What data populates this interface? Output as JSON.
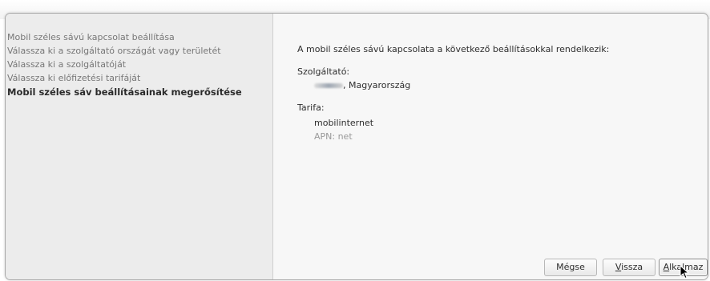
{
  "sidebar": {
    "steps": [
      "Mobil széles sávú kapcsolat beállítása",
      "Válassza ki a szolgáltató országát vagy területét",
      "Válassza ki a szolgáltatóját",
      "Válassza ki előfizetési tarifáját",
      "Mobil széles sáv beállításainak megerősítése"
    ],
    "active_index": 4
  },
  "summary": {
    "intro": "A mobil széles sávú kapcsolata a következő beállításokkal rendelkezik:",
    "provider_label": "Szolgáltató:",
    "provider_value": ", Magyarország",
    "plan_label": "Tarifa:",
    "plan_value": "mobilinternet",
    "apn": "APN: net"
  },
  "buttons": {
    "cancel": "Mégse",
    "back_mnemonic": "V",
    "back_rest": "issza",
    "apply_mnemonic": "A",
    "apply_rest": "lkalmaz"
  }
}
